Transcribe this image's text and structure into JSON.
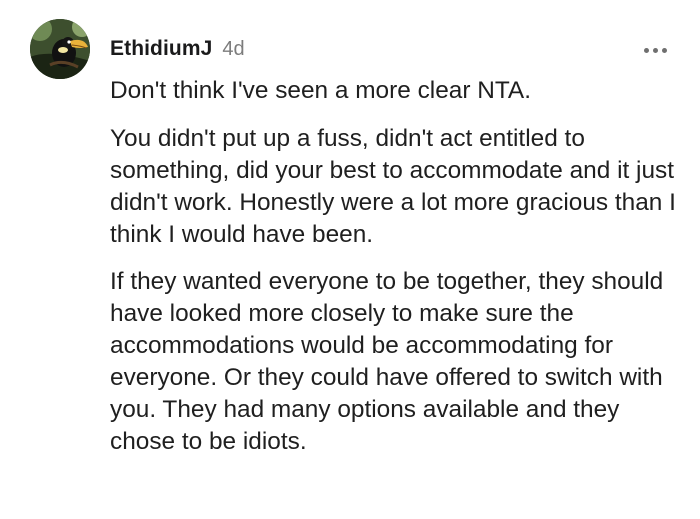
{
  "comment": {
    "username": "EthidiumJ",
    "timestamp": "4d",
    "more_icon": "more-horizontal-icon",
    "avatar_icon": "toucan-avatar",
    "paragraphs": [
      "Don't think I've seen a more clear NTA.",
      "You didn't put up a fuss, didn't act entitled to something, did your best to accommodate and it just didn't work. Honestly were a lot more gracious than I think I would have been.",
      "If they wanted everyone to be together, they should have looked more closely to make sure the accommodations would be accommodating for everyone. Or they could have offered to switch with you. They had many options available and they chose to be idiots."
    ]
  },
  "colors": {
    "text": "#1f1f1f",
    "username": "#1a1a1b",
    "timestamp": "#7c7c7c",
    "icon": "#6f6f6f",
    "background": "#ffffff"
  }
}
